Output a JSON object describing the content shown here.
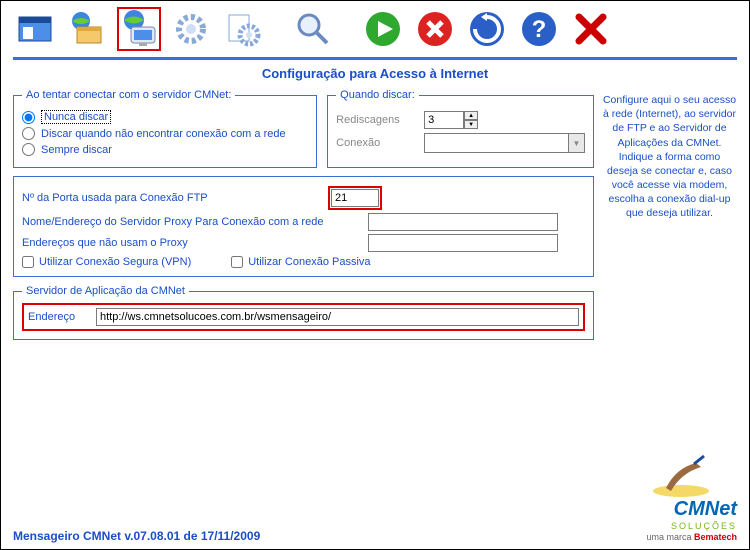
{
  "title": "Configuração para Acesso à Internet",
  "help_text": "Configure aqui o seu acesso à rede (Internet), ao servidor de FTP e ao Servidor de Aplicações da CMNet.\nIndique a forma como deseja se conectar e, caso você acesse via modem, escolha a conexão dial-up que deseja utilizar.",
  "groups": {
    "connect": {
      "legend": "Ao tentar conectar com o servidor CMNet:",
      "options": [
        "Nunca discar",
        "Discar quando não encontrar conexão com a rede",
        "Sempre discar"
      ],
      "selected": 0
    },
    "dial": {
      "legend": "Quando discar:",
      "redial_label": "Rediscagens",
      "redial_value": "3",
      "conn_label": "Conexão",
      "conn_value": ""
    },
    "ftp": {
      "port_label": "Nº da Porta usada para Conexão FTP",
      "port_value": "21",
      "proxy_label": "Nome/Endereço do Servidor Proxy Para Conexão com a rede",
      "proxy_value": "",
      "noproxy_label": "Endereços  que não usam o Proxy",
      "noproxy_value": "",
      "vpn_label": "Utilizar Conexão Segura (VPN)",
      "passive_label": "Utilizar Conexão Passiva"
    },
    "appserver": {
      "legend": "Servidor de Aplicação da CMNet",
      "addr_label": "Endereço",
      "addr_value": "http://ws.cmnetsolucoes.com.br/wsmensageiro/"
    }
  },
  "footer": "Mensageiro CMNet v.07.08.01 de 17/11/2009",
  "logo": {
    "name": "CMNet",
    "sub": "SOLUÇÕES",
    "brand_pre": "uma marca ",
    "brand": "Bematech"
  },
  "icons": {
    "window": "window-icon",
    "folder": "folder-globe-icon",
    "monitor": "monitor-globe-icon",
    "gear1": "gear1-icon",
    "gear2": "gear2-icon",
    "search": "search-icon",
    "play": "play-icon",
    "stop": "stop-icon",
    "refresh": "refresh-icon",
    "help": "help-icon",
    "close": "close-icon"
  }
}
